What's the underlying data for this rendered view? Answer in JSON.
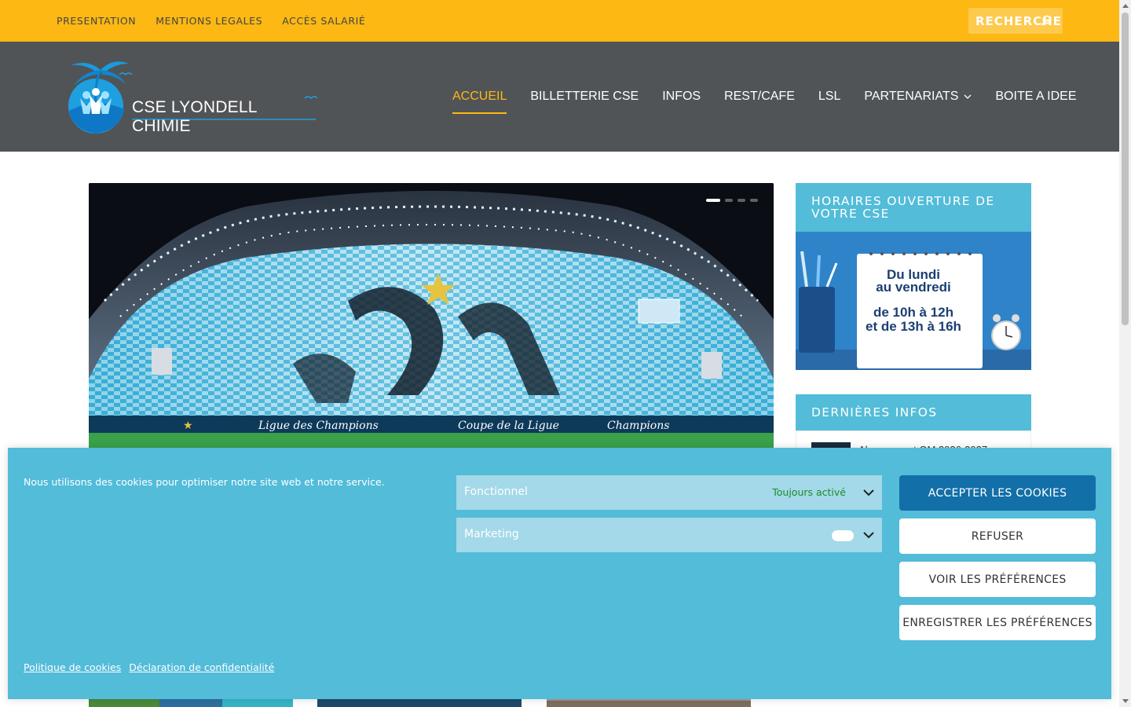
{
  "topbar": {
    "links": [
      "PRESENTATION",
      "MENTIONS LEGALES",
      "ACCÈS SALARIÉ"
    ],
    "search_label": "RECHERCHE"
  },
  "header": {
    "logo_text": "CSE LYONDELL CHIMIE",
    "nav": [
      {
        "label": "ACCUEIL",
        "active": true
      },
      {
        "label": "BILLETTERIE CSE"
      },
      {
        "label": "INFOS"
      },
      {
        "label": "REST/CAFE"
      },
      {
        "label": "LSL"
      },
      {
        "label": "PARTENARIATS",
        "dropdown": true
      },
      {
        "label": "BOITE A IDEE"
      }
    ]
  },
  "slider": {
    "slide_count": 4,
    "active_slide": 1,
    "banner_texts": [
      "Ligue des Champions",
      "Coupe de la Ligue",
      "Champions"
    ]
  },
  "sidebar": {
    "hours_title": "HORAIRES OUVERTURE DE VOTRE CSE",
    "hours_card": [
      "Du lundi",
      "au vendredi",
      "de 10h à 12h",
      "et de 13h à 16h"
    ],
    "news_title": "DERNIÈRES INFOS",
    "news_first_item": "Abonnement OM 2026-2027"
  },
  "cookie_banner": {
    "message": "Nous utilisons des cookies pour optimiser notre site web et notre service.",
    "categories": [
      {
        "name": "Fonctionnel",
        "status": "Toujours activé"
      },
      {
        "name": "Marketing",
        "status": ""
      }
    ],
    "buttons": {
      "accept": "ACCEPTER LES COOKIES",
      "refuse": "REFUSER",
      "view_prefs": "VOIR LES PRÉFÉRENCES",
      "save_prefs": "ENREGISTRER LES PRÉFÉRENCES"
    },
    "links": [
      "Politique de cookies",
      "Déclaration de confidentialité"
    ]
  },
  "colors": {
    "topbar": "#fdb813",
    "header": "#515457",
    "accent_blue": "#52bcd9",
    "primary_button": "#126fa8"
  }
}
